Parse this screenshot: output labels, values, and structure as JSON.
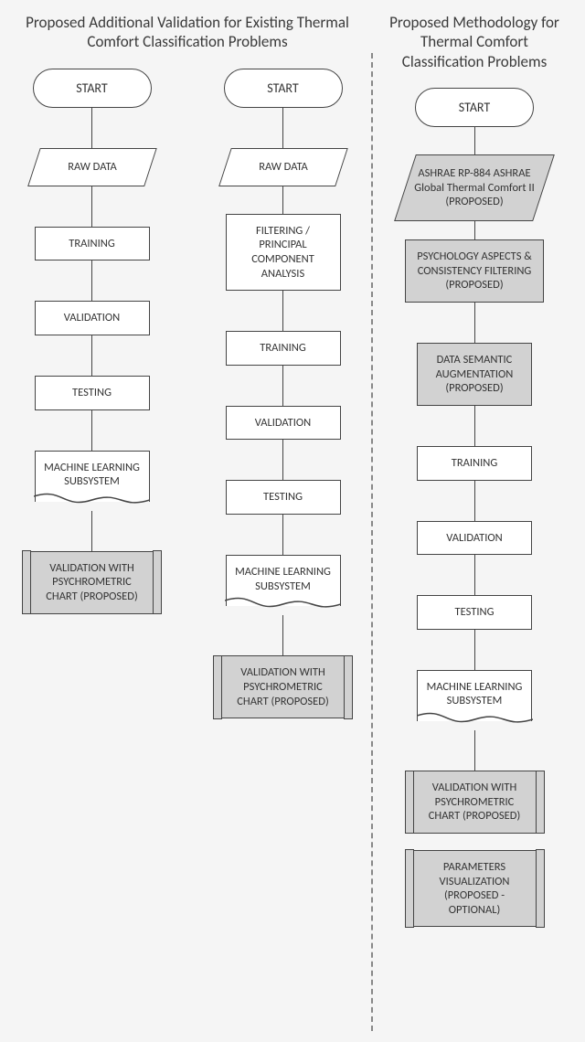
{
  "titles": {
    "left": "Proposed Additional Validation for Existing Thermal Comfort Classification Problems",
    "right": "Proposed Methodology for Thermal Comfort Classification Problems"
  },
  "labels": {
    "start": "START",
    "raw_data": "RAW DATA",
    "filtering_pca": "FILTERING / PRINCIPAL COMPONENT ANALYSIS",
    "training": "TRAINING",
    "validation": "VALIDATION",
    "testing": "TESTING",
    "ml_subsystem": "MACHINE LEARNING SUBSYSTEM",
    "psychro_validation": "VALIDATION WITH PSYCHROMETRIC CHART (PROPOSED)",
    "ashrae_data": "ASHRAE RP-884 ASHRAE Global Thermal Comfort II (PROPOSED)",
    "psych_filter": "PSYCHOLOGY ASPECTS & CONSISTENCY FILTERING (PROPOSED)",
    "semantic_aug": "DATA SEMANTIC AUGMENTATION (PROPOSED)",
    "param_viz": "PARAMETERS VISUALIZATION (PROPOSED - OPTIONAL)"
  }
}
